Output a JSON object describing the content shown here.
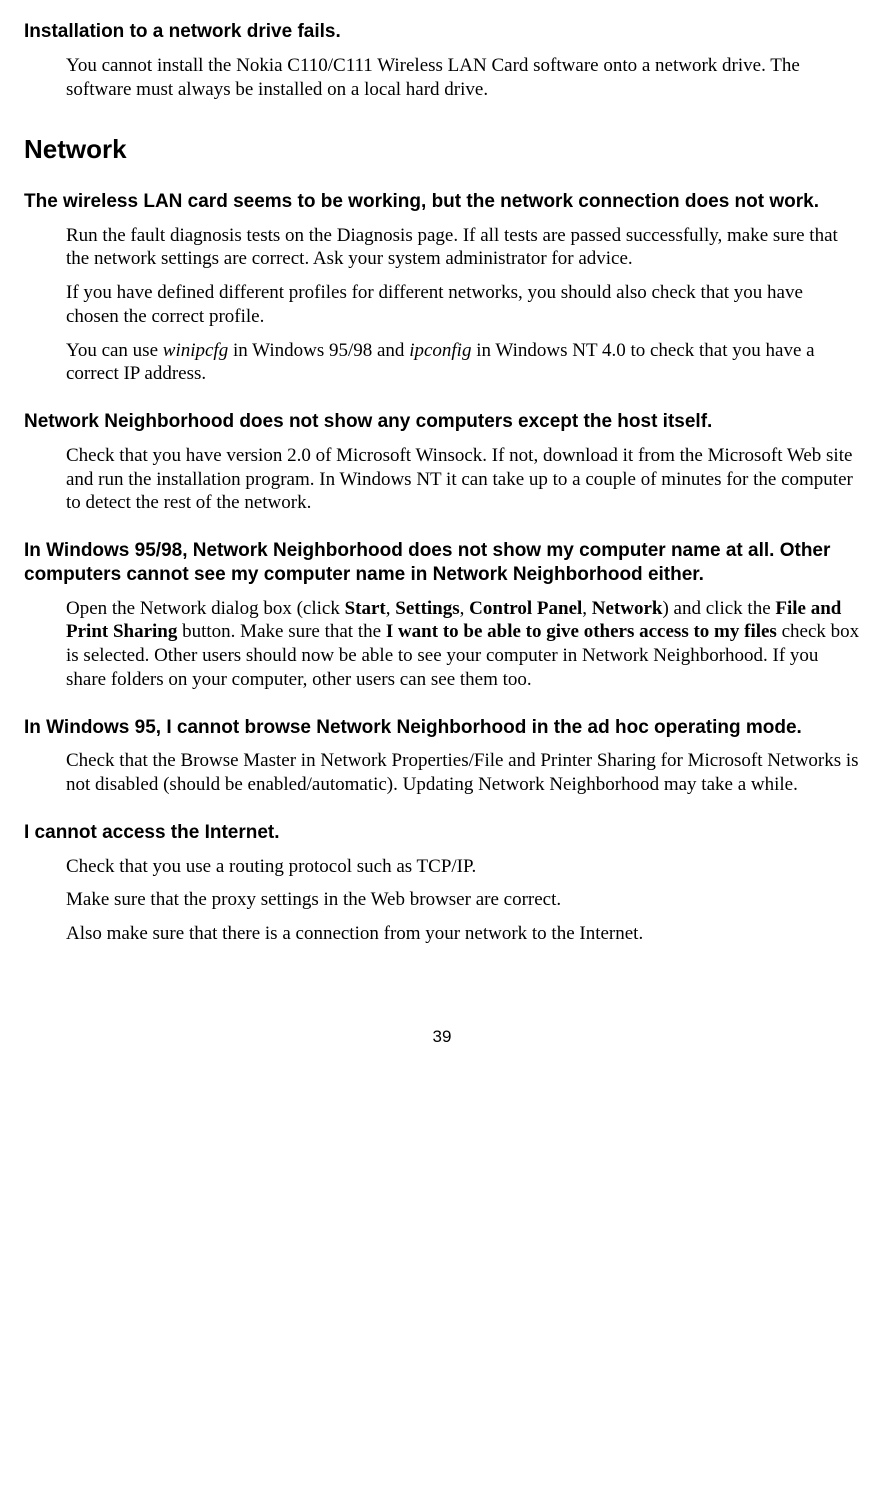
{
  "issue1": {
    "title": "Installation to a network drive fails.",
    "p1": "You cannot install the Nokia C110/C111 Wireless LAN Card software onto a network drive. The software must always be installed on a local hard drive."
  },
  "section1": "Network",
  "issue2": {
    "title": "The wireless LAN card seems to be working, but the network connection does not work.",
    "p1": "Run the fault diagnosis tests on the Diagnosis page. If all tests are passed successfully, make sure that the network settings are correct. Ask your system administrator for advice.",
    "p2": "If you have defined different profiles for different networks, you should also check that you have chosen the correct profile.",
    "p3a": "You can use ",
    "p3b": "winipcfg",
    "p3c": " in Windows 95/98 and ",
    "p3d": " ipconfig",
    "p3e": " in Windows NT 4.0 to check that you have a correct IP address."
  },
  "issue3": {
    "title": "Network Neighborhood does not show any computers except the host itself.",
    "p1": "Check that you have version 2.0 of Microsoft Winsock. If not, download it from the Microsoft Web site and run the installation program. In Windows NT it can take up to a couple of minutes for the computer to detect the rest of the network."
  },
  "issue4": {
    "title": "In Windows 95/98, Network Neighborhood does not show my computer name at all. Other computers cannot see my computer name in Network Neighborhood either.",
    "p1a": "Open the Network dialog box (click ",
    "p1b": "Start",
    "p1c": ", ",
    "p1d": "Settings",
    "p1e": ", ",
    "p1f": "Control Panel",
    "p1g": ", ",
    "p1h": "Network",
    "p1i": ") and click the ",
    "p1j": "File and Print Sharing",
    "p1k": " button. Make sure that the ",
    "p1l": "I want to be able to give others access to my files",
    "p1m": " check box is selected. Other users should now be able to see your computer in Network Neighborhood. If you share folders on your computer, other users can see them too."
  },
  "issue5": {
    "title": "In Windows 95, I cannot browse Network Neighborhood in the ad hoc operating mode.",
    "p1": "Check that the Browse Master in Network Properties/File and Printer Sharing for Microsoft Networks is not disabled (should be enabled/automatic). Updating Network Neighborhood may take a while."
  },
  "issue6": {
    "title": "I cannot access the Internet.",
    "p1": "Check that you use a routing protocol such as TCP/IP.",
    "p2": "Make sure that the proxy settings in the Web browser are correct.",
    "p3": "Also make sure that there is a connection from your network to the Internet."
  },
  "pageNumber": "39"
}
